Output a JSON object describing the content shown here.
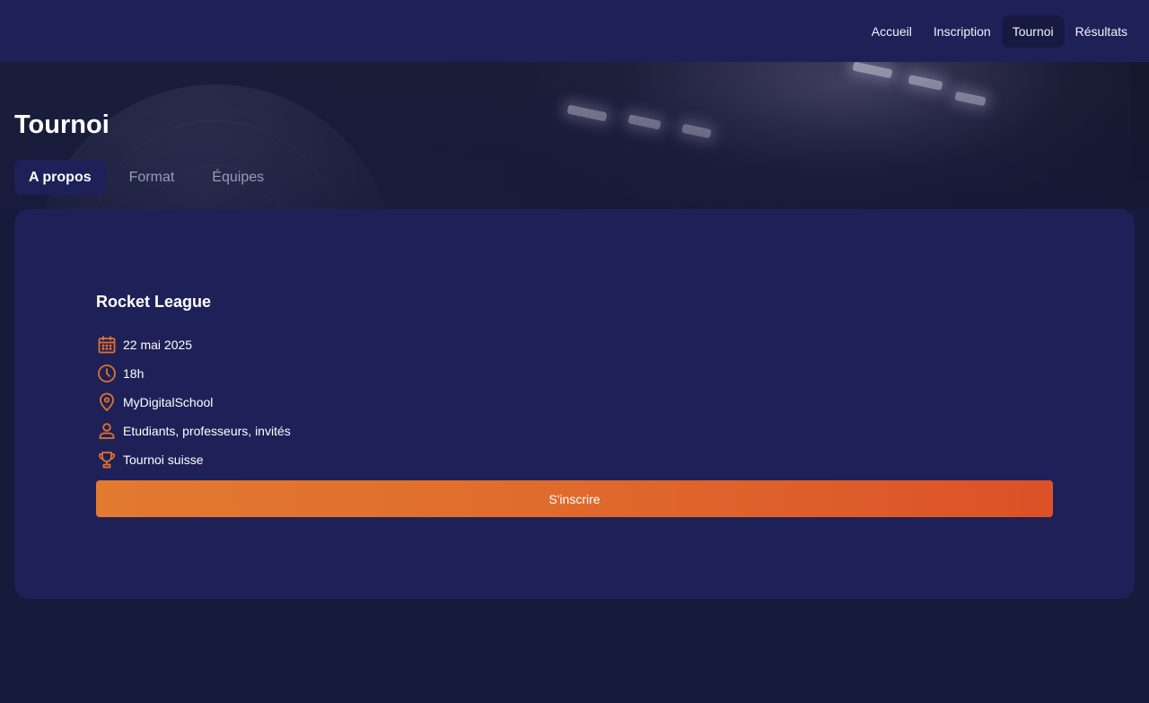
{
  "nav": {
    "items": [
      {
        "label": "Accueil",
        "active": false
      },
      {
        "label": "Inscription",
        "active": false
      },
      {
        "label": "Tournoi",
        "active": true
      },
      {
        "label": "Résultats",
        "active": false
      }
    ]
  },
  "hero": {
    "title": "Tournoi"
  },
  "tabs": [
    {
      "label": "A propos",
      "active": true
    },
    {
      "label": "Format",
      "active": false
    },
    {
      "label": "Équipes",
      "active": false
    }
  ],
  "event": {
    "game": "Rocket League",
    "details": [
      {
        "icon": "calendar-icon",
        "text": "22 mai 2025"
      },
      {
        "icon": "clock-icon",
        "text": "18h"
      },
      {
        "icon": "location-pin-icon",
        "text": "MyDigitalSchool"
      },
      {
        "icon": "user-icon",
        "text": "Etudiants, professeurs, invités"
      },
      {
        "icon": "trophy-icon",
        "text": "Tournoi suisse"
      }
    ],
    "cta_label": "S'inscrire"
  },
  "colors": {
    "accent": "#e2702d",
    "navy": "#1e2158",
    "background": "#161a3b"
  }
}
